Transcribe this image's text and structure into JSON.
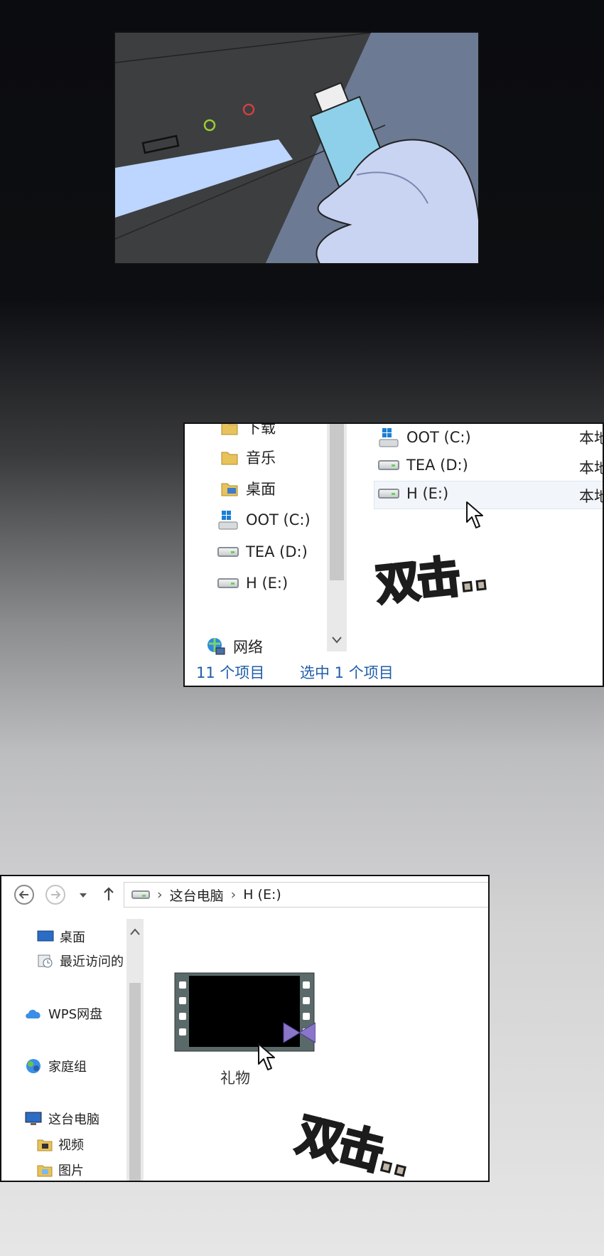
{
  "explorer1": {
    "nav_items": [
      "下载",
      "音乐",
      "桌面",
      "OOT (C:)",
      "TEA (D:)",
      "H (E:)"
    ],
    "network_label": "网络",
    "drives": [
      {
        "label": "OOT (C:)",
        "type": "本地"
      },
      {
        "label": "TEA (D:)",
        "type": "本地"
      },
      {
        "label": "H (E:)",
        "type": "本地"
      }
    ],
    "status_count": "11 个项目",
    "status_selected": "选中 1 个项目",
    "sfx": "双击.."
  },
  "explorer2": {
    "breadcrumb": [
      "这台电脑",
      "H (E:)"
    ],
    "nav_items": [
      "桌面",
      "最近访问的",
      "WPS网盘",
      "家庭组",
      "这台电脑",
      "视频",
      "图片"
    ],
    "file_label": "礼物",
    "sfx": "双击.."
  }
}
